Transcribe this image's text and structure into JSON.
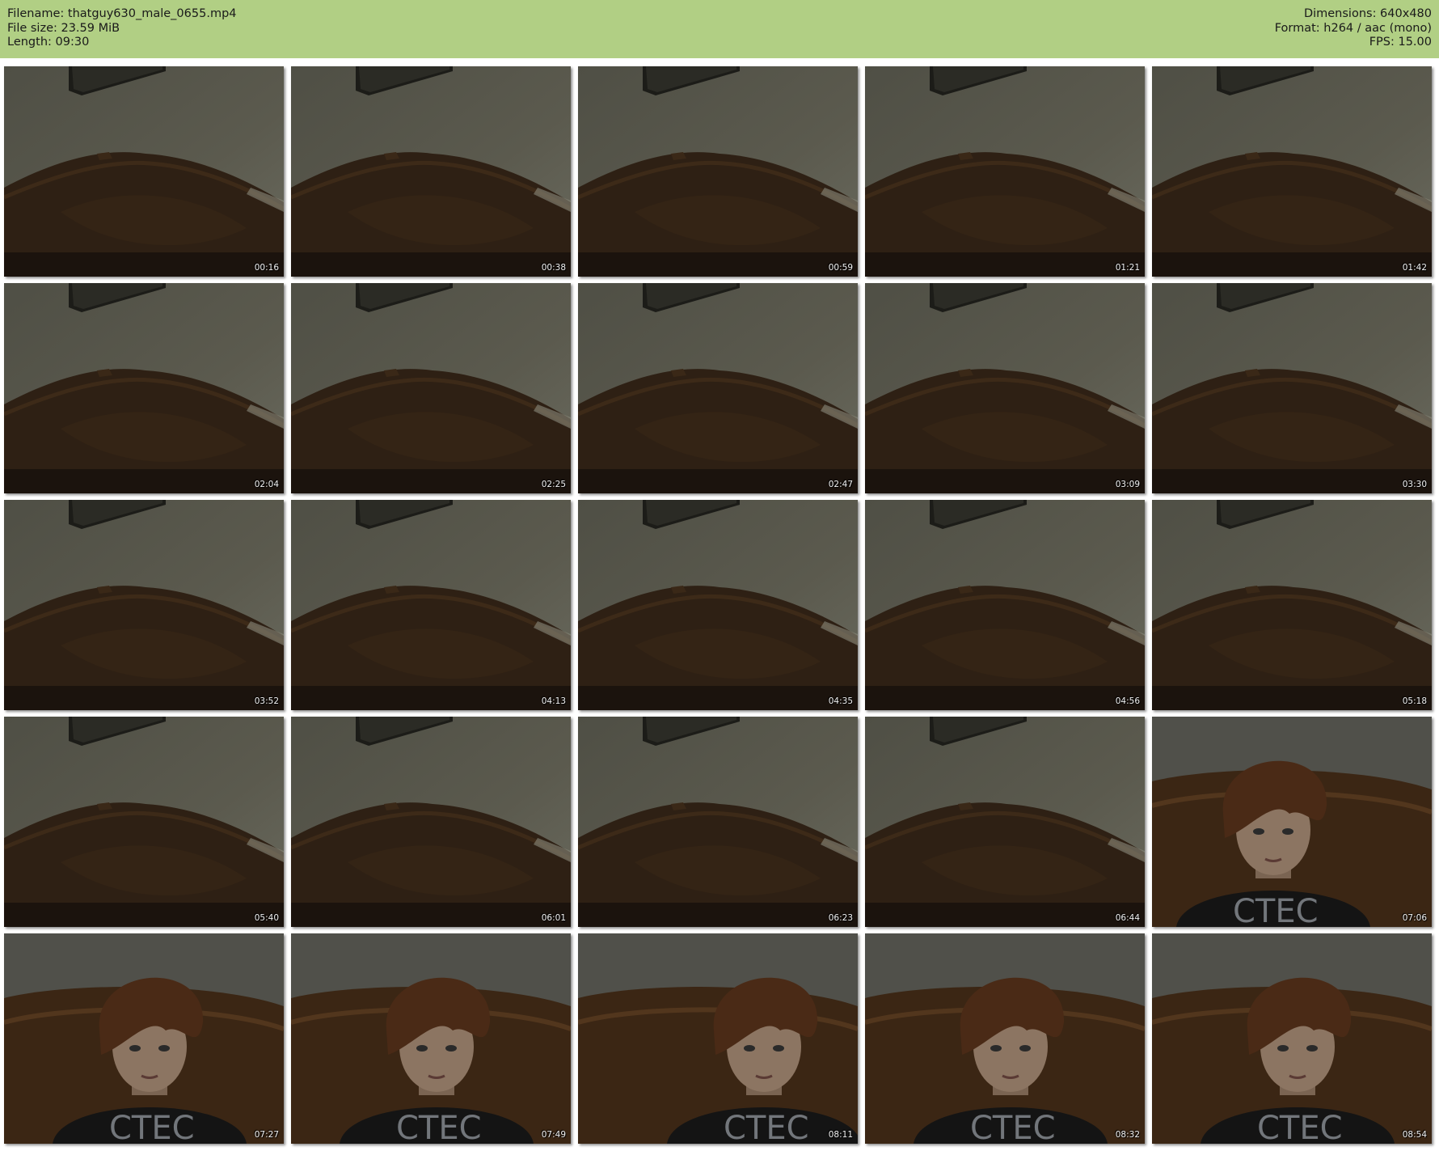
{
  "header": {
    "filename_line": "Filename: thatguy630_male_0655.mp4",
    "filesize_line": "File size: 23.59 MiB",
    "length_line": "Length: 09:30",
    "dimensions_line": "Dimensions: 640x480",
    "format_line": "Format: h264 / aac (mono)",
    "fps_line": "FPS: 15.00"
  },
  "colors": {
    "header_bg": "#b1cf84",
    "wall": "#5b5a4e",
    "headboard": "#2e2014",
    "hair": "#4a2a16",
    "shirt": "#141414"
  },
  "thumbnails": [
    {
      "time": "00:16",
      "scene": "empty-room"
    },
    {
      "time": "00:38",
      "scene": "empty-room"
    },
    {
      "time": "00:59",
      "scene": "empty-room"
    },
    {
      "time": "01:21",
      "scene": "empty-room"
    },
    {
      "time": "01:42",
      "scene": "empty-room"
    },
    {
      "time": "02:04",
      "scene": "empty-room"
    },
    {
      "time": "02:25",
      "scene": "empty-room"
    },
    {
      "time": "02:47",
      "scene": "empty-room"
    },
    {
      "time": "03:09",
      "scene": "empty-room"
    },
    {
      "time": "03:30",
      "scene": "empty-room"
    },
    {
      "time": "03:52",
      "scene": "empty-room"
    },
    {
      "time": "04:13",
      "scene": "empty-room"
    },
    {
      "time": "04:35",
      "scene": "empty-room"
    },
    {
      "time": "04:56",
      "scene": "empty-room"
    },
    {
      "time": "05:18",
      "scene": "empty-room"
    },
    {
      "time": "05:40",
      "scene": "empty-room"
    },
    {
      "time": "06:01",
      "scene": "empty-room"
    },
    {
      "time": "06:23",
      "scene": "empty-room"
    },
    {
      "time": "06:44",
      "scene": "empty-room"
    },
    {
      "time": "07:06",
      "scene": "person"
    },
    {
      "time": "07:27",
      "scene": "person"
    },
    {
      "time": "07:49",
      "scene": "person"
    },
    {
      "time": "08:11",
      "scene": "person"
    },
    {
      "time": "08:32",
      "scene": "person"
    },
    {
      "time": "08:54",
      "scene": "person"
    }
  ]
}
